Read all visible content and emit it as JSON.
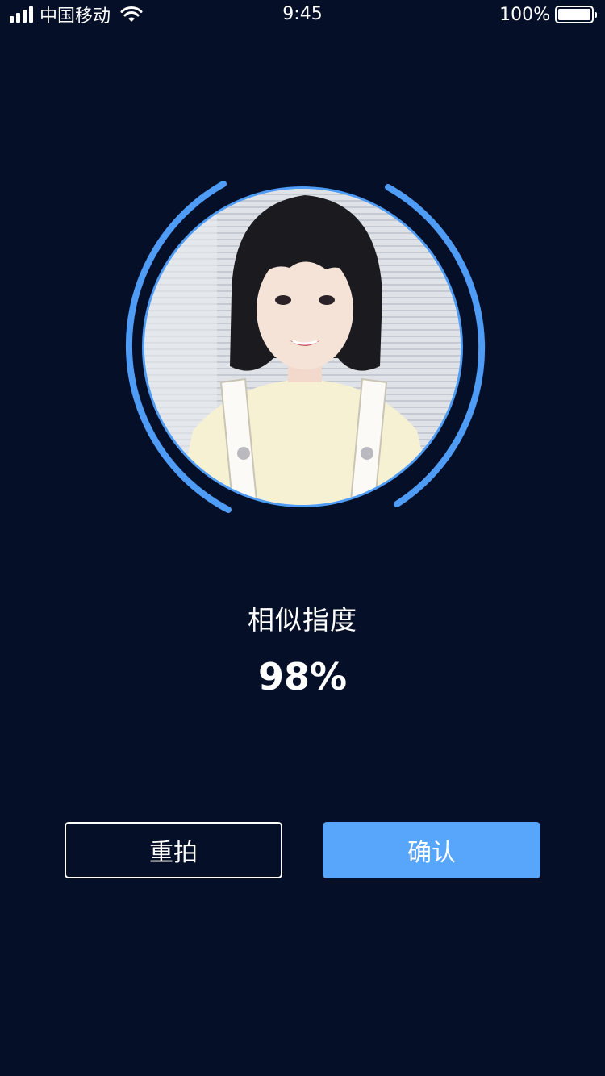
{
  "status_bar": {
    "carrier": "中国移动",
    "time": "9:45",
    "battery": "100%",
    "battery_level": 1.0,
    "icons": [
      "signal-icon",
      "wifi-icon",
      "battery-icon"
    ]
  },
  "result": {
    "label": "相似指度",
    "value": "98%"
  },
  "buttons": {
    "retake_label": "重拍",
    "confirm_label": "确认"
  },
  "colors": {
    "background": "#060f28",
    "accent": "#57a6fb",
    "ring": "#4e9cf5"
  }
}
